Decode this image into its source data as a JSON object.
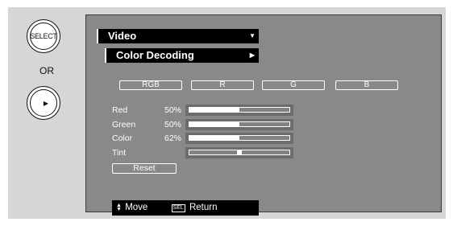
{
  "remote": {
    "select_label": "SELECT",
    "or_label": "OR",
    "right_glyph": "▶"
  },
  "menu": {
    "title": "Video",
    "title_arrow": "▼",
    "submenu": "Color Decoding",
    "submenu_arrow": "▶"
  },
  "channels": [
    "RGB",
    "R",
    "G",
    "B"
  ],
  "adjustments": [
    {
      "label": "Red",
      "value": "50%",
      "level": 0.5
    },
    {
      "label": "Green",
      "value": "50%",
      "level": 0.5
    },
    {
      "label": "Color",
      "value": "62%",
      "level": 0.5
    },
    {
      "label": "Tint",
      "value": "",
      "level": 0.5
    }
  ],
  "reset_label": "Reset",
  "help": {
    "move_icon": "▲▼",
    "move_label": "Move",
    "sel_badge": "SEL",
    "return_label": "Return"
  }
}
